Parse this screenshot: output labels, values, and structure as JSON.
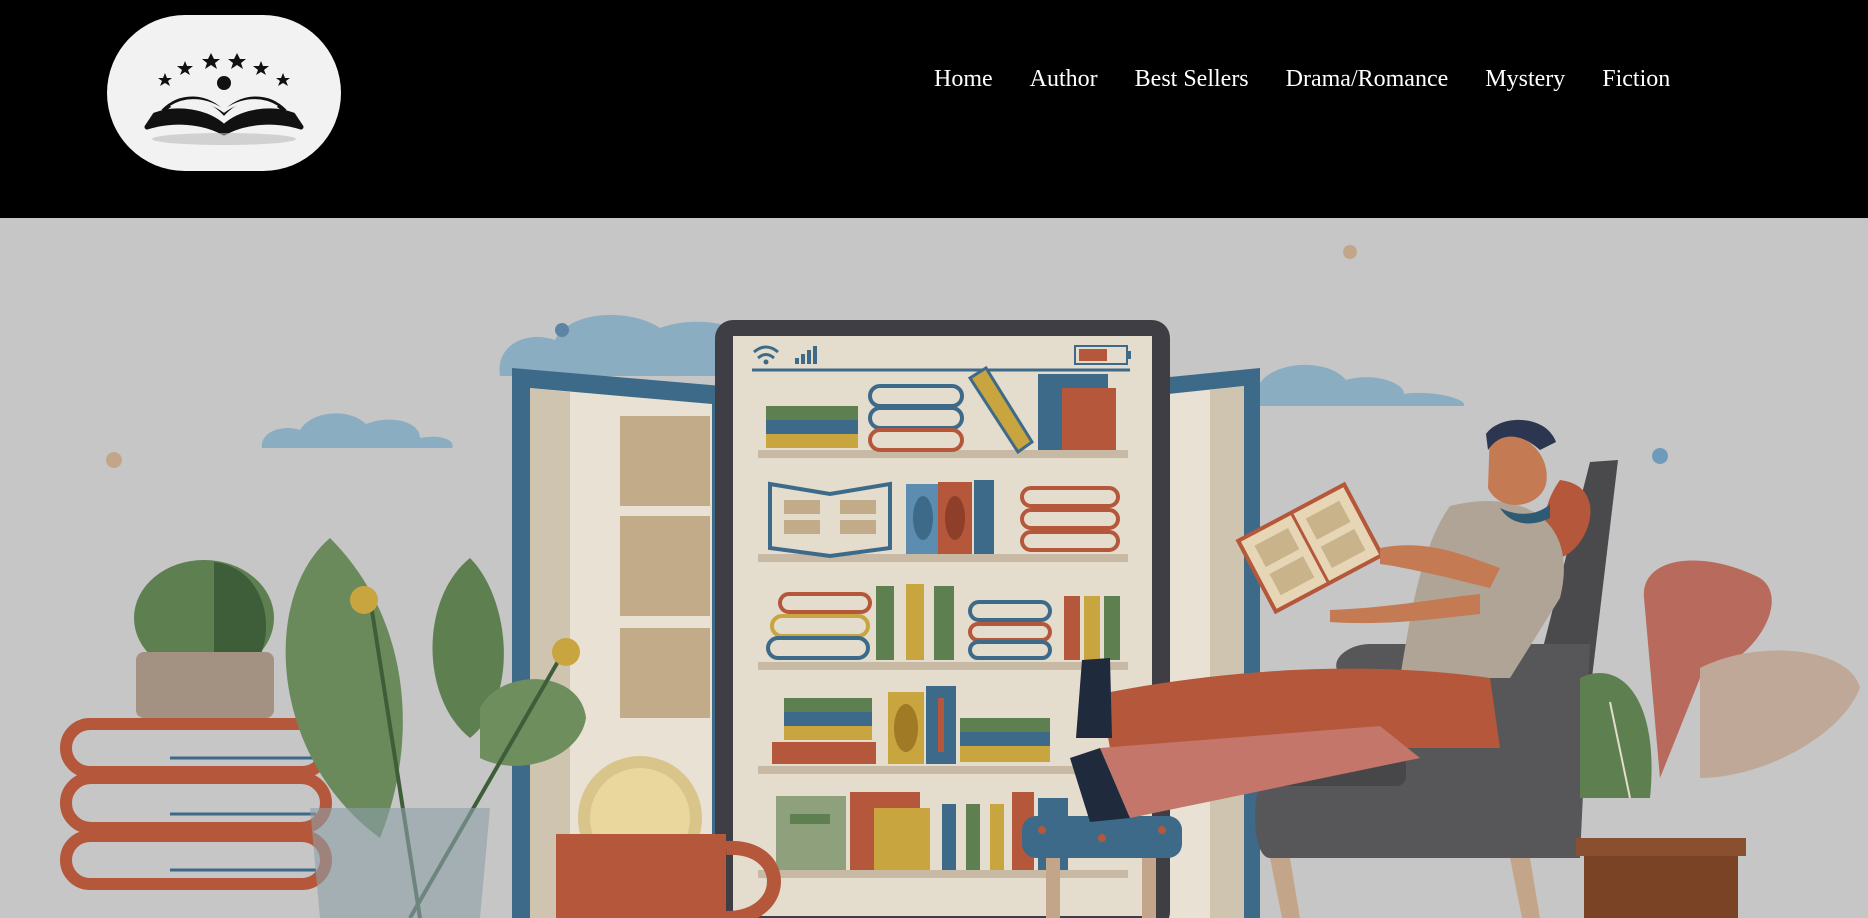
{
  "header": {
    "logo": {
      "icon": "open-book-stars-logo",
      "background": "#f2f2f2"
    },
    "nav": [
      {
        "label": "Home"
      },
      {
        "label": "Author"
      },
      {
        "label": "Best Sellers"
      },
      {
        "label": "Drama/Romance"
      },
      {
        "label": "Mystery"
      },
      {
        "label": "Fiction"
      }
    ]
  },
  "hero": {
    "illustration": "reader-in-armchair-with-tablet-bookshelf",
    "colors": {
      "background": "#c6c6c6",
      "cloud": "#8aadc2",
      "tablet_frame": "#3e3e44",
      "screen": "#e4dccc",
      "rust": "#b4573b",
      "navy": "#3e6a8a",
      "green": "#5e7f50",
      "mustard": "#c9a540",
      "chair": "#575759"
    }
  }
}
